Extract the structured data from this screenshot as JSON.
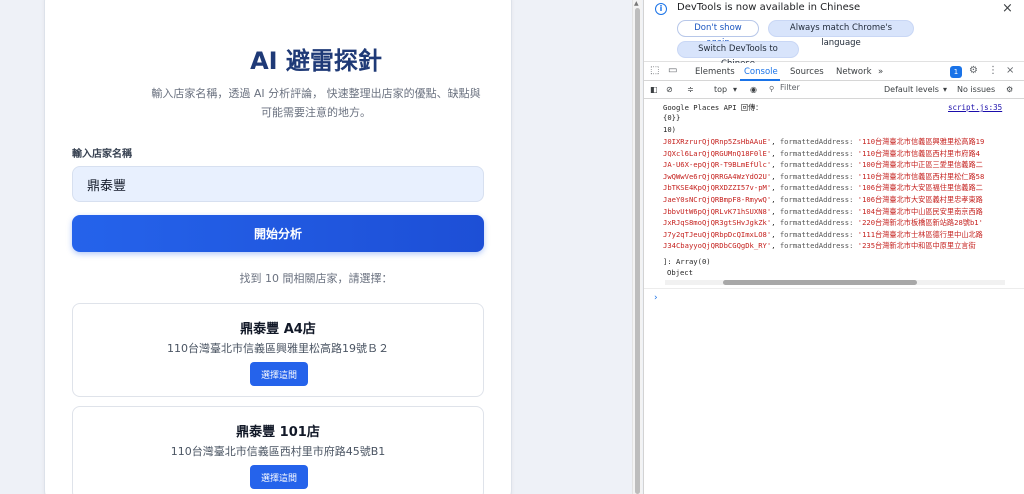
{
  "app": {
    "title": "AI 避雷探針",
    "description_line1": "輸入店家名稱，透過 AI 分析評論， 快速整理出店家的優點、缺點與",
    "description_line2": "可能需要注意的地方。",
    "input_label": "輸入店家名稱",
    "input_value": "鼎泰豐",
    "analyze_button": "開始分析",
    "found_text": "找到 10 間相關店家，請選擇：",
    "results": [
      {
        "name": "鼎泰豐 A4店",
        "address": "110台灣臺北市信義區興雅里松高路19號Ｂ２",
        "button": "選擇這間"
      },
      {
        "name": "鼎泰豐 101店",
        "address": "110台灣臺北市信義區西村里市府路45號B1",
        "button": "選擇這間"
      }
    ]
  },
  "devtools": {
    "infobar": {
      "message": "DevTools is now available in Chinese",
      "dont_show": "Don't show again",
      "match_language": "Always match Chrome's language",
      "switch_language": "Switch DevTools to Chinese"
    },
    "tabs": [
      "Elements",
      "Console",
      "Sources",
      "Network"
    ],
    "active_tab": "Console",
    "more_tabs": "»",
    "issues_count": "1",
    "toolbar": {
      "context": "top",
      "filter_placeholder": "Filter",
      "levels": "Default levels",
      "issues": "No issues"
    },
    "console": {
      "log_header": "Google Places API 回傳：",
      "source_link": "script.js:35",
      "obj_open": "{0}} ",
      "count_line": "10)",
      "rows": [
        {
          "id": "J0IXRzrurQjQRnp5ZsHbAAuE'",
          "addr": "'110台灣臺北市信義區興雅里松高路19"
        },
        {
          "id": "JQXcl6LarQjQRGUMnQ18F0lE'",
          "addr": "'110台灣臺北市信義區西村里市府路4"
        },
        {
          "id": "JA-U6X-epQjQR-T9BLmEfUlc'",
          "addr": "'100台灣臺北市中正區三愛里信義路二"
        },
        {
          "id": "JwQWwVe6rQjQRRGA4WzYdO2U'",
          "addr": "'110台灣臺北市信義區西村里松仁路58"
        },
        {
          "id": "JbTKSE4KpQjQRXDZZI57v-pM'",
          "addr": "'106台灣臺北市大安區福住里信義路二"
        },
        {
          "id": "JaeY0sNCrQjQRBmpF8-RmywQ'",
          "addr": "'106台灣臺北市大安區義村里忠孝東路"
        },
        {
          "id": "JbbvUtW6pQjQRLvK71hSUXN8'",
          "addr": "'104台灣臺北市中山區民安里南京西路"
        },
        {
          "id": "JxRJqS8moQjQR3gtSHvJgkZk'",
          "addr": "'220台灣新北市板橋區新站路28號b1'"
        },
        {
          "id": "J7y2qTJeuQjQRbpDcQImxLO8'",
          "addr": "'111台灣臺北市士林區德行里中山北路"
        },
        {
          "id": "J34CbayyoQjQRDbCGQgDk_RY'",
          "addr": "'235台灣新北市中和區中原里立言街"
        }
      ],
      "formatted_key": "formattedAddress:",
      "array_line": "]: Array(0)",
      "object_line": "Object",
      "prompt": "›"
    }
  }
}
